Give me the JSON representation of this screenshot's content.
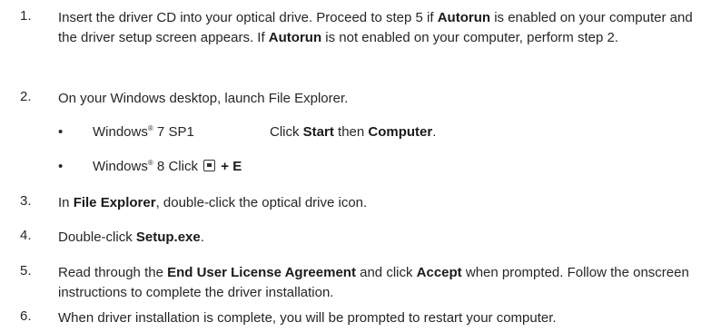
{
  "steps": [
    {
      "number": "1.",
      "parts": [
        {
          "text": "Insert the driver CD into your optical drive. Proceed to step 5 if "
        },
        {
          "text": "Autorun",
          "bold": true
        },
        {
          "text": " is enabled on your computer and the driver setup screen appears. If "
        },
        {
          "text": "Autorun",
          "bold": true
        },
        {
          "text": " is not enabled on your computer, perform step 2."
        }
      ]
    },
    {
      "number": "2.",
      "parts": [
        {
          "text": "On your Windows desktop, launch File Explorer."
        }
      ]
    },
    {
      "number": "3.",
      "parts": [
        {
          "text": "In "
        },
        {
          "text": "File Explorer",
          "bold": true
        },
        {
          "text": ", double-click the optical drive icon."
        }
      ]
    },
    {
      "number": "4.",
      "parts": [
        {
          "text": "Double-click "
        },
        {
          "text": "Setup.exe",
          "bold": true
        },
        {
          "text": "."
        }
      ]
    },
    {
      "number": "5.",
      "parts": [
        {
          "text": "Read through the "
        },
        {
          "text": "End User License Agreement",
          "bold": true
        },
        {
          "text": " and click "
        },
        {
          "text": "Accept",
          "bold": true
        },
        {
          "text": " when prompted. Follow the onscreen instructions to complete the driver installation."
        }
      ]
    },
    {
      "number": "6.",
      "parts": [
        {
          "text": "When driver installation is complete, you will be prompted to restart your computer."
        }
      ]
    }
  ],
  "sub_items": [
    {
      "bullet": "•",
      "os": "Windows",
      "mark": "®",
      "version": " 7 SP1",
      "action_prefix": "Click ",
      "action_b1": "Start",
      "action_mid": " then ",
      "action_b2": "Computer",
      "action_suffix": "."
    },
    {
      "bullet": "•",
      "os": "Windows",
      "mark": "®",
      "version": " 8 Click ",
      "key_icon": "windows-key-icon",
      "shortcut": "+ E"
    }
  ]
}
